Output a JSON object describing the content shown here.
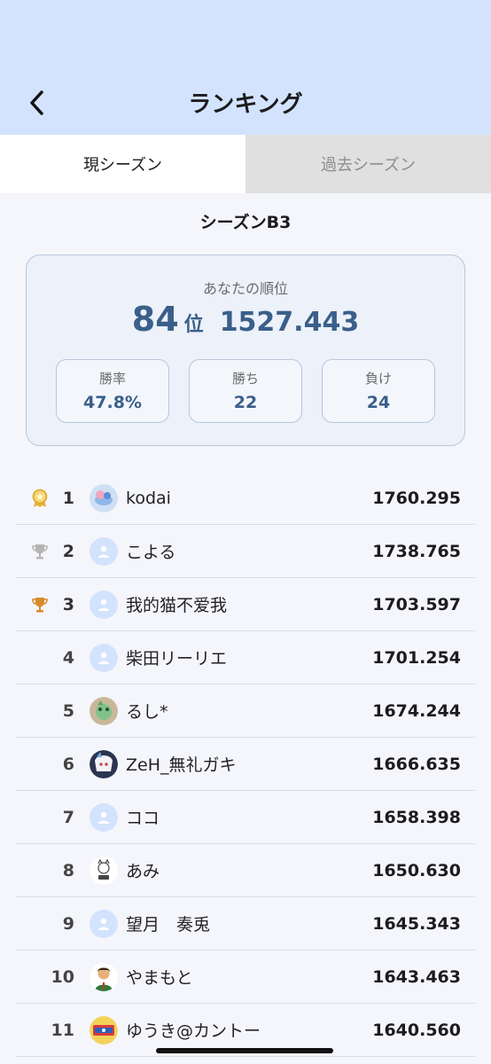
{
  "header": {
    "title": "ランキング",
    "back_icon": "chevron-left-icon"
  },
  "tabs": [
    {
      "label": "現シーズン",
      "active": true
    },
    {
      "label": "過去シーズン",
      "active": false
    }
  ],
  "season": {
    "title": "シーズンB3"
  },
  "my_rank": {
    "label": "あなたの順位",
    "rank": "84",
    "rank_unit": "位",
    "score": "1527.443",
    "stats": [
      {
        "label": "勝率",
        "value": "47.8%"
      },
      {
        "label": "勝ち",
        "value": "22"
      },
      {
        "label": "負け",
        "value": "24"
      }
    ]
  },
  "colors": {
    "header_bg": "#d3e3fd",
    "accent": "#3a5f8a",
    "gold": "#f2c94c",
    "silver": "#b5b5b5",
    "bronze": "#d98a2b"
  },
  "ranking": [
    {
      "rank": "1",
      "name": "kodai",
      "score": "1760.295",
      "trophy": "gold-trophy-icon",
      "avatar": "photo"
    },
    {
      "rank": "2",
      "name": "こよる",
      "score": "1738.765",
      "trophy": "silver-trophy-icon",
      "avatar": "default"
    },
    {
      "rank": "3",
      "name": "我的猫不爱我",
      "score": "1703.597",
      "trophy": "bronze-trophy-icon",
      "avatar": "default"
    },
    {
      "rank": "4",
      "name": "柴田リーリエ",
      "score": "1701.254",
      "trophy": "",
      "avatar": "default"
    },
    {
      "rank": "5",
      "name": "るし*",
      "score": "1674.244",
      "trophy": "",
      "avatar": "photo"
    },
    {
      "rank": "6",
      "name": "ZeH_無礼ガキ",
      "score": "1666.635",
      "trophy": "",
      "avatar": "photo"
    },
    {
      "rank": "7",
      "name": "ココ",
      "score": "1658.398",
      "trophy": "",
      "avatar": "default"
    },
    {
      "rank": "8",
      "name": "あみ",
      "score": "1650.630",
      "trophy": "",
      "avatar": "photo"
    },
    {
      "rank": "9",
      "name": "望月　奏兎",
      "score": "1645.343",
      "trophy": "",
      "avatar": "default"
    },
    {
      "rank": "10",
      "name": "やまもと",
      "score": "1643.463",
      "trophy": "",
      "avatar": "photo"
    },
    {
      "rank": "11",
      "name": "ゆうき@カントー",
      "score": "1640.560",
      "trophy": "",
      "avatar": "photo"
    }
  ]
}
